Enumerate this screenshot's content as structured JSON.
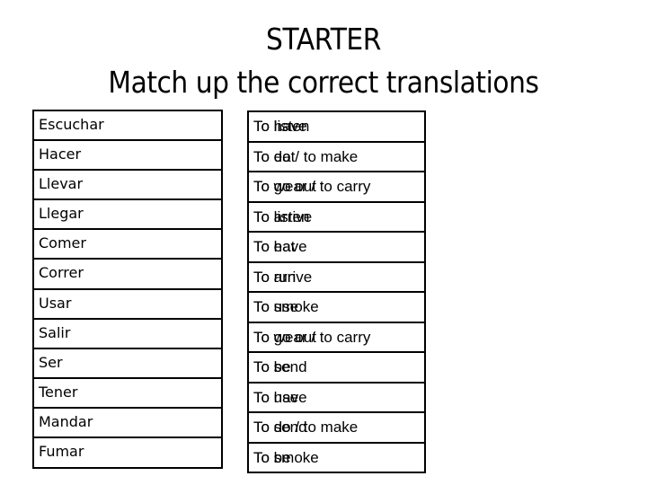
{
  "title": {
    "line1": "STARTER",
    "line2": "Match up the correct translations"
  },
  "spanish_words": [
    "Escuchar",
    "Hacer",
    "Llevar",
    "Llegar",
    "Comer",
    "Correr",
    "Usar",
    "Salir",
    "Ser",
    "Tener",
    "Mandar",
    "Fumar"
  ],
  "english_translations": [
    {
      "primary": "To listen",
      "overlay": "To have"
    },
    {
      "primary": "To do / to make",
      "overlay": "To eat"
    },
    {
      "primary": "To wear / to carry",
      "overlay": "To go out"
    },
    {
      "primary": "To listen",
      "overlay": "To arrive"
    },
    {
      "primary": "To have",
      "overlay": "To eat"
    },
    {
      "primary": "To arrive",
      "overlay": "To run"
    },
    {
      "primary": "To smoke",
      "overlay": "To use"
    },
    {
      "primary": "To wear / to carry",
      "overlay": "To go out"
    },
    {
      "primary": "To send",
      "overlay": "To be"
    },
    {
      "primary": "To have",
      "overlay": "To use"
    },
    {
      "primary": "To do / to make",
      "overlay": "To send"
    },
    {
      "primary": "To smoke",
      "overlay": "To be"
    }
  ]
}
